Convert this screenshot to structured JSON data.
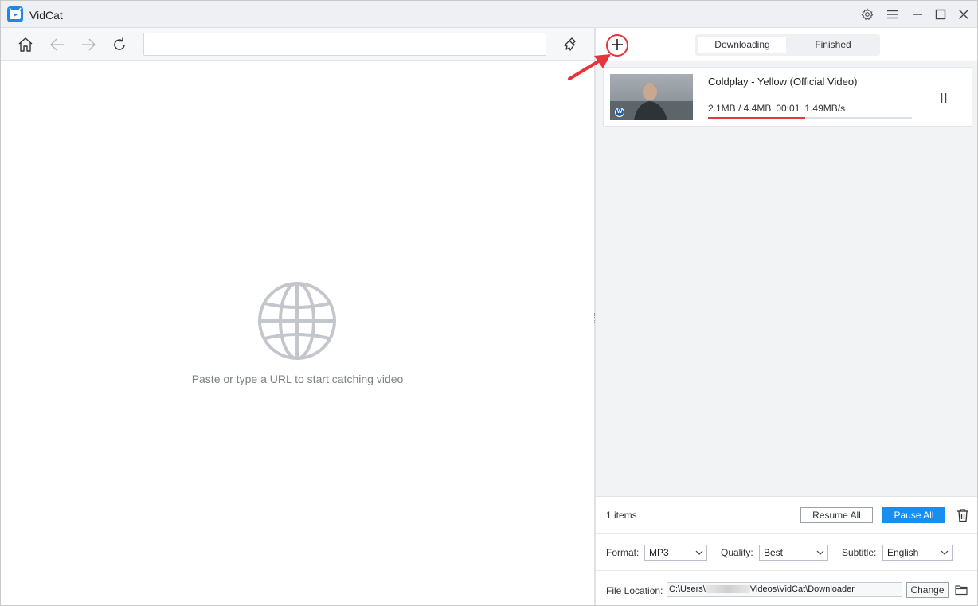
{
  "app": {
    "title": "VidCat"
  },
  "window_controls": [
    "gear-icon",
    "menu-icon",
    "minimize-icon",
    "maximize-icon",
    "close-icon"
  ],
  "browser": {
    "url_value": "",
    "url_placeholder": "",
    "empty_hint": "Paste or type a URL to start catching video"
  },
  "downloads": {
    "tabs": [
      {
        "label": "Downloading",
        "active": true
      },
      {
        "label": "Finished",
        "active": false
      }
    ],
    "items": [
      {
        "title": "Coldplay - Yellow (Official Video)",
        "size": "2.1MB / 4.4MB",
        "elapsed": "00:01",
        "speed": "1.49MB/s",
        "progress_fraction": 0.477
      }
    ]
  },
  "footer": {
    "items_count": "1 items",
    "resume_all": "Resume All",
    "pause_all": "Pause All",
    "format_label": "Format:",
    "format_value": "MP3",
    "quality_label": "Quality:",
    "quality_value": "Best",
    "subtitle_label": "Subtitle:",
    "subtitle_value": "English",
    "file_location_label": "File Location:",
    "path_prefix": "C:\\Users\\",
    "path_suffix": "Videos\\VidCat\\Downloader",
    "change_label": "Change"
  },
  "colors": {
    "accent": "#1a8ef0",
    "progress": "#e0393f",
    "annotation": "#e8333a"
  }
}
